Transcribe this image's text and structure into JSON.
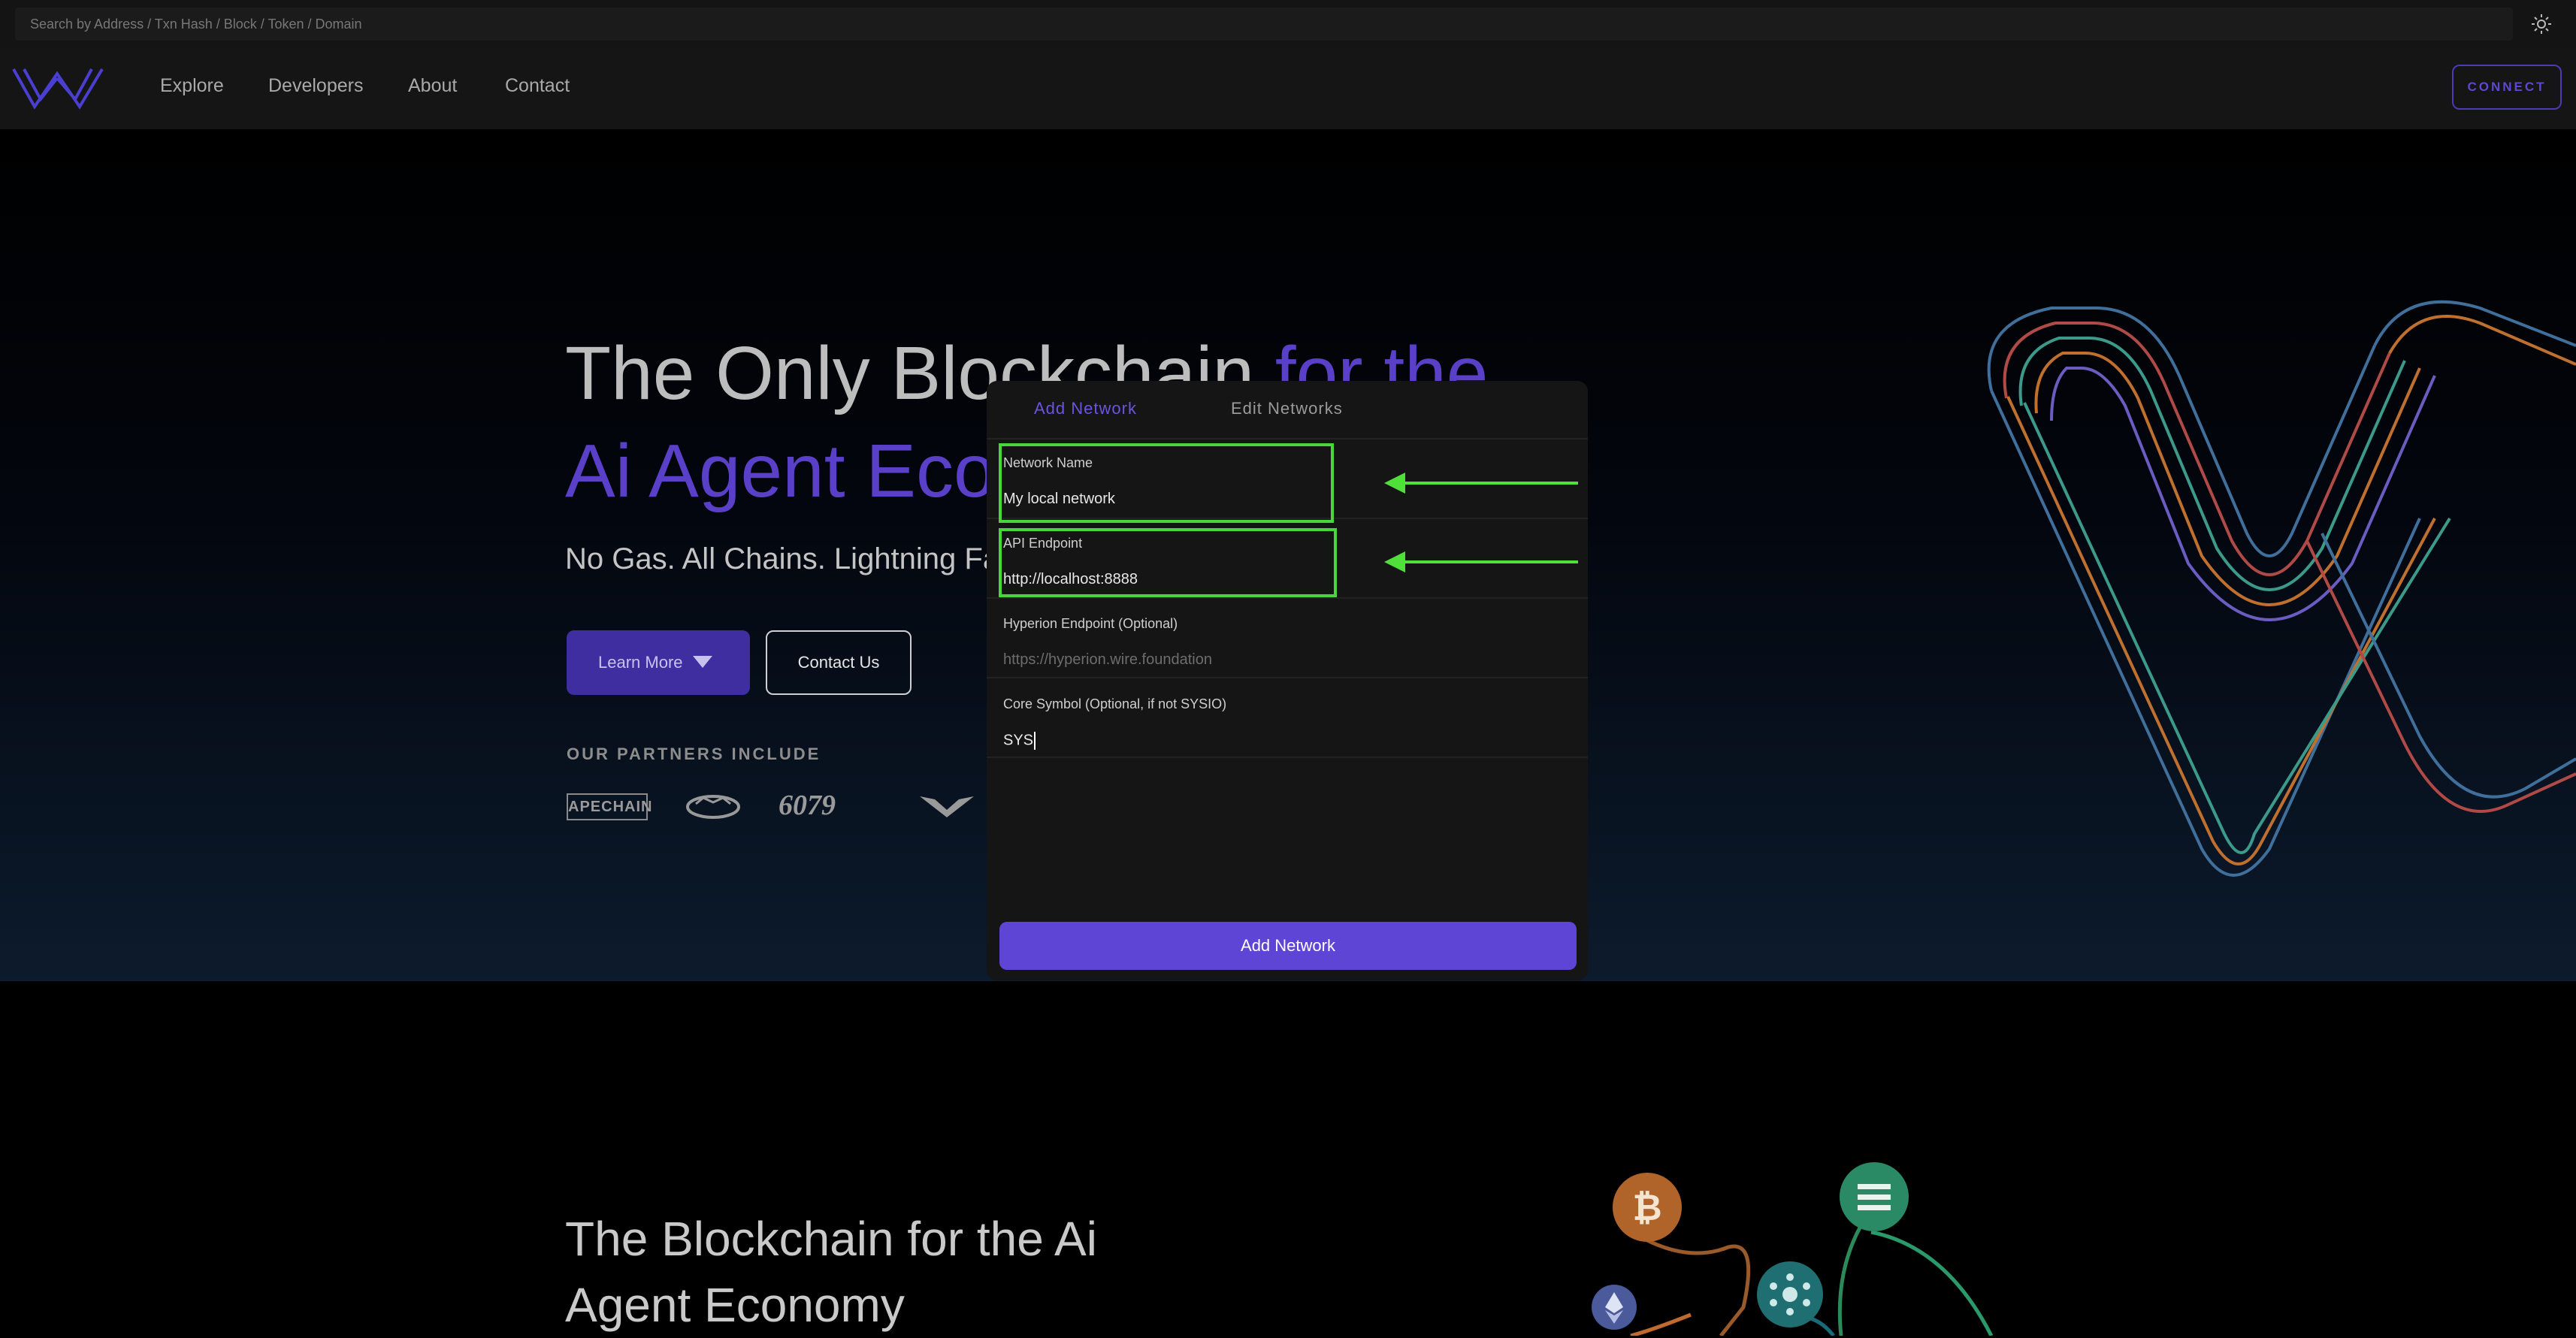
{
  "search": {
    "placeholder": "Search by Address / Txn Hash / Block / Token / Domain"
  },
  "nav": {
    "links": [
      {
        "label": "Explore"
      },
      {
        "label": "Developers"
      },
      {
        "label": "About"
      },
      {
        "label": "Contact"
      }
    ],
    "connect_label": "CONNECT"
  },
  "hero": {
    "title_part1": "The Only Blockchain ",
    "title_part2": "for the",
    "title_line2": "Ai Agent Econ",
    "subtitle": "No Gas. All Chains. Lightning Fa",
    "learn_more_label": "Learn More",
    "contact_label": "Contact Us",
    "partners_title": "OUR PARTNERS INCLUDE",
    "partners": [
      "APECHAIN",
      "6079"
    ]
  },
  "section2": {
    "title": "The Blockchain for the Ai Agent Economy"
  },
  "modal": {
    "tabs": [
      {
        "label": "Add Network",
        "active": true
      },
      {
        "label": "Edit Networks",
        "active": false
      }
    ],
    "fields": [
      {
        "label": "Network Name",
        "value": "My local network",
        "placeholder": ""
      },
      {
        "label": "API Endpoint",
        "value": "http://localhost:8888",
        "placeholder": ""
      },
      {
        "label": "Hyperion Endpoint (Optional)",
        "value": "",
        "placeholder": "https://hyperion.wire.foundation"
      },
      {
        "label": "Core Symbol (Optional, if not SYSIO)",
        "value": "SYS",
        "placeholder": ""
      }
    ],
    "submit_label": "Add Network"
  },
  "icons": [
    "sun-icon",
    "wire-logo-icon",
    "caret-down-icon",
    "bitcoin-icon",
    "solana-icon",
    "cardano-icon",
    "ethereum-icon"
  ],
  "colors": {
    "accent": "#5f45d6",
    "highlight": "#49d63b",
    "background": "#000000"
  }
}
